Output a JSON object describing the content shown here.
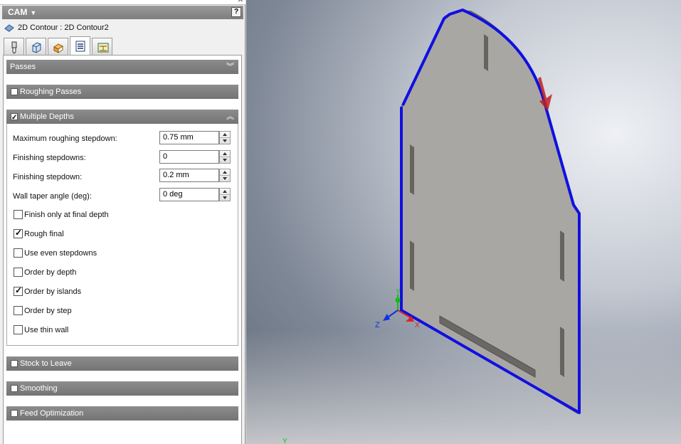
{
  "app": {
    "panel_title": "CAM",
    "help_label": "?",
    "operation_title": "2D Contour : 2D Contour2"
  },
  "tabs": [
    {
      "icon": "tool-icon",
      "active": false
    },
    {
      "icon": "geometry-icon",
      "active": false
    },
    {
      "icon": "heights-icon",
      "active": false
    },
    {
      "icon": "passes-icon",
      "active": true
    },
    {
      "icon": "linking-icon",
      "active": false
    }
  ],
  "groups": {
    "passes": "Passes",
    "roughing": {
      "label": "Roughing Passes",
      "checked": false
    },
    "multiple_depths": {
      "label": "Multiple Depths",
      "checked": true
    },
    "stock": {
      "label": "Stock to Leave",
      "checked": false
    },
    "smoothing": {
      "label": "Smoothing",
      "checked": false
    },
    "feed": {
      "label": "Feed Optimization",
      "checked": false
    }
  },
  "fields": {
    "max_stepdown": {
      "label": "Maximum roughing stepdown:",
      "value": "0.75 mm"
    },
    "finishing_stepdowns": {
      "label": "Finishing stepdowns:",
      "value": "0"
    },
    "finishing_stepdown": {
      "label": "Finishing stepdown:",
      "value": "0.2 mm"
    },
    "wall_taper": {
      "label": "Wall taper angle (deg):",
      "value": "0 deg"
    }
  },
  "checkboxes": [
    {
      "label": "Finish only at final depth",
      "checked": false
    },
    {
      "label": "Rough final",
      "checked": true
    },
    {
      "label": "Use even stepdowns",
      "checked": false
    },
    {
      "label": "Order by depth",
      "checked": false
    },
    {
      "label": "Order by islands",
      "checked": true
    },
    {
      "label": "Order by step",
      "checked": false
    },
    {
      "label": "Use thin wall",
      "checked": false
    }
  ],
  "viewport": {
    "axis_z": "Z",
    "axis_y": "Y",
    "axis_x": "X",
    "bottom_axis_y": "Y",
    "colors": {
      "toolpath": "#1010e0",
      "part": "#a8a6a2",
      "arrow": "#c02020"
    }
  }
}
